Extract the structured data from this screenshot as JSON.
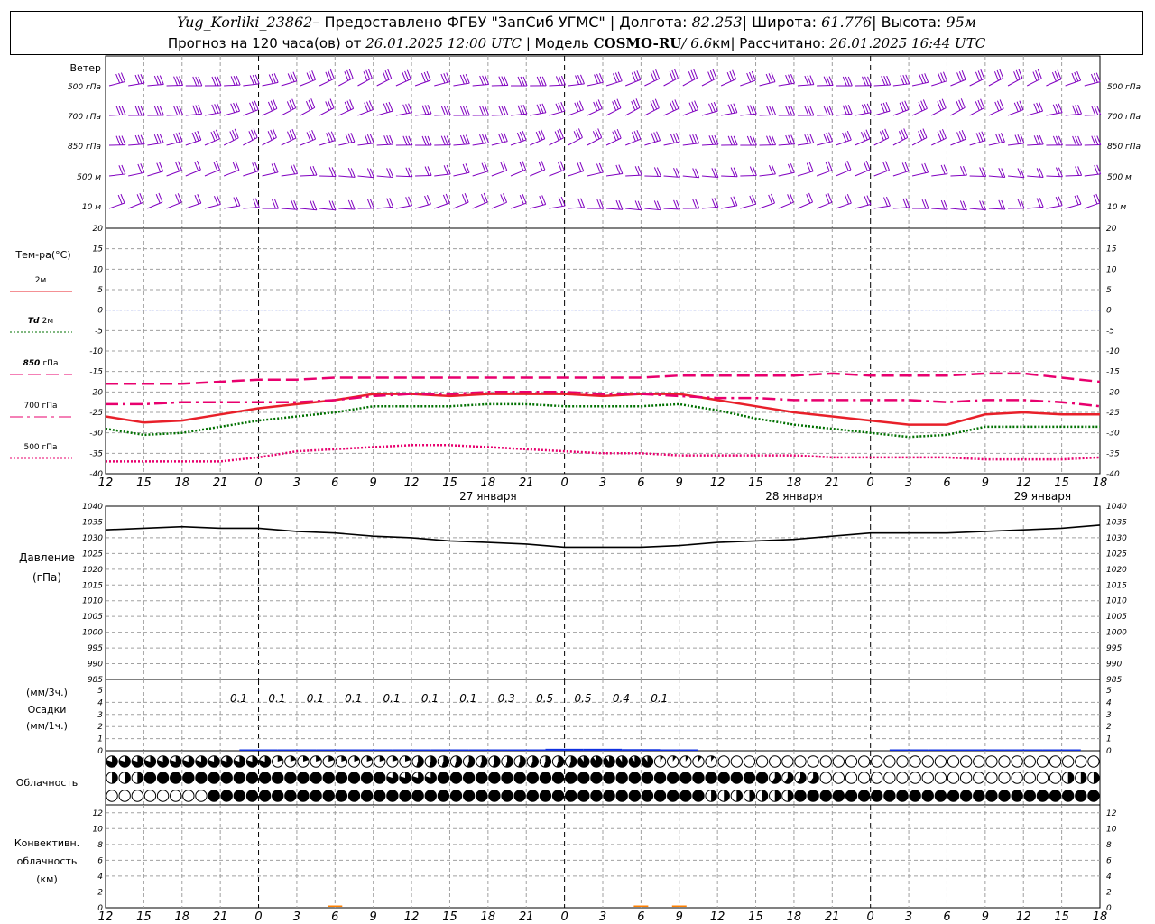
{
  "header": {
    "station": "Yug_Korliki_23862",
    "provided_prefix": " – Предоставлено ФГБУ \"ЗапСиб УГМС\" | Долгота:",
    "lon": "82.253",
    "lat_label": " | Широта:",
    "lat": "61.776",
    "alt_label": " | Высота:",
    "alt": "95м",
    "forecast_prefix": "Прогноз на 120 часа(ов) от",
    "forecast_time": "26.01.2025 12:00 UTC",
    "model_label": " | Модель",
    "model": "COSMO-RU",
    "resolution": " / 6.6",
    "resolution_unit": "км",
    "calc_label": " | Рассчитано:",
    "calc_time": "26.01.2025 16:44 UTC"
  },
  "time_axis": {
    "hour_labels": [
      "12",
      "15",
      "18",
      "21",
      "0",
      "3",
      "6",
      "9",
      "12",
      "15",
      "18",
      "21",
      "0",
      "3",
      "6",
      "9",
      "12",
      "15",
      "18",
      "21",
      "0",
      "3",
      "6",
      "9",
      "12",
      "15",
      "18"
    ],
    "date_labels": [
      {
        "text": "27 января",
        "at_index": 10
      },
      {
        "text": "28 января",
        "at_index": 18
      },
      {
        "text": "29 января",
        "at_index": 24.5
      }
    ]
  },
  "wind_panel": {
    "title": "Ветер",
    "levels": [
      "500 гПа",
      "700 гПа",
      "850 гПа",
      "500 м",
      "10 м"
    ],
    "barb_color": "#8000c0"
  },
  "temp_panel": {
    "title": "Тем-ра(°C)",
    "legend": [
      {
        "label": "2м",
        "color": "#e8202a",
        "style": "solid"
      },
      {
        "label_italic": "Td",
        "label": "2м",
        "color": "#007000",
        "style": "dotted"
      },
      {
        "label_italic": "850",
        "label": "гПа",
        "color": "#e8006e",
        "style": "dashed"
      },
      {
        "label": "700 гПа",
        "color": "#e8006e",
        "style": "dashdot"
      },
      {
        "label": "500 гПа",
        "color": "#e8006e",
        "style": "dotted"
      }
    ],
    "ticks": [
      "20",
      "15",
      "10",
      "5",
      "0",
      "-5",
      "-10",
      "-15",
      "-20",
      "-25",
      "-30",
      "-35",
      "-40"
    ]
  },
  "pressure_panel": {
    "title1": "Давление",
    "title2": "(гПа)",
    "ticks": [
      "1040",
      "1035",
      "1030",
      "1025",
      "1020",
      "1015",
      "1010",
      "1005",
      "1000",
      "995",
      "990",
      "985"
    ]
  },
  "precip_panel": {
    "title1": "(мм/3ч.)",
    "title2": "Осадки",
    "title3": "(мм/1ч.)",
    "ticks": [
      "5",
      "4",
      "3",
      "2",
      "1",
      "0"
    ],
    "amounts": [
      "0.1",
      "0.1",
      "0.1",
      "0.1",
      "0.1",
      "0.1",
      "0.1",
      "0.3",
      "0.5",
      "0.5",
      "0.4",
      "0.1"
    ]
  },
  "cloud_panel": {
    "title": "Облачность"
  },
  "conv_panel": {
    "title1": "Конвективн.",
    "title2": "облачность",
    "title3": "(км)",
    "ticks": [
      "12",
      "10",
      "8",
      "6",
      "4",
      "2",
      "0"
    ]
  },
  "chart_data": [
    {
      "type": "line",
      "title": "Тем-ра(°C)",
      "x": [
        "12",
        "15",
        "18",
        "21",
        "0",
        "3",
        "6",
        "9",
        "12",
        "15",
        "18",
        "21",
        "0",
        "3",
        "6",
        "9",
        "12",
        "15",
        "18",
        "21",
        "0",
        "3",
        "6",
        "9",
        "12",
        "15",
        "18"
      ],
      "ylim": [
        -40,
        20
      ],
      "series": [
        {
          "name": "2м",
          "color": "#e8202a",
          "values": [
            -26,
            -27.5,
            -27,
            -25.5,
            -24,
            -23,
            -22,
            -20.5,
            -20.5,
            -21,
            -20.5,
            -20.5,
            -20.5,
            -21,
            -20.5,
            -20.5,
            -22,
            -23.5,
            -25,
            -26,
            -27,
            -28,
            -28,
            -25.5,
            -25,
            -25.5,
            -25.5
          ]
        },
        {
          "name": "Td 2м",
          "color": "#007000",
          "values": [
            -29,
            -30.5,
            -30,
            -28.5,
            -27,
            -26,
            -25,
            -23.5,
            -23.5,
            -23.5,
            -23,
            -23,
            -23.5,
            -23.5,
            -23.5,
            -23,
            -24.5,
            -26.5,
            -28,
            -29,
            -30,
            -31,
            -30.5,
            -28.5,
            -28.5,
            -28.5,
            -28.5
          ]
        },
        {
          "name": "850 гПа",
          "color": "#e8006e",
          "values": [
            -18,
            -18,
            -18,
            -17.5,
            -17,
            -17,
            -16.5,
            -16.5,
            -16.5,
            -16.5,
            -16.5,
            -16.5,
            -16.5,
            -16.5,
            -16.5,
            -16,
            -16,
            -16,
            -16,
            -15.5,
            -16,
            -16,
            -16,
            -15.5,
            -15.5,
            -16.5,
            -17.5
          ]
        },
        {
          "name": "700 гПа",
          "color": "#e8006e",
          "values": [
            -23,
            -23,
            -22.5,
            -22.5,
            -22.5,
            -22.5,
            -22,
            -21,
            -20.5,
            -20.5,
            -20,
            -20,
            -20,
            -20.5,
            -20.5,
            -21,
            -21.5,
            -21.5,
            -22,
            -22,
            -22,
            -22,
            -22.5,
            -22,
            -22,
            -22.5,
            -23.5
          ]
        },
        {
          "name": "500 гПа",
          "color": "#e8006e",
          "values": [
            -37,
            -37,
            -37,
            -37,
            -36,
            -34.5,
            -34,
            -33.5,
            -33,
            -33,
            -33.5,
            -34,
            -34.5,
            -35,
            -35,
            -35.5,
            -35.5,
            -35.5,
            -35.5,
            -36,
            -36,
            -36,
            -36,
            -36.5,
            -36.5,
            -36.5,
            -36
          ]
        }
      ]
    },
    {
      "type": "line",
      "title": "Давление (гПа)",
      "x": [
        "12",
        "15",
        "18",
        "21",
        "0",
        "3",
        "6",
        "9",
        "12",
        "15",
        "18",
        "21",
        "0",
        "3",
        "6",
        "9",
        "12",
        "15",
        "18",
        "21",
        "0",
        "3",
        "6",
        "9",
        "12",
        "15",
        "18"
      ],
      "ylim": [
        985,
        1040
      ],
      "series": [
        {
          "name": "Давление",
          "color": "#000000",
          "values": [
            1032.5,
            1033,
            1033.5,
            1033,
            1033,
            1032,
            1031.5,
            1030.5,
            1030,
            1029,
            1028.5,
            1028,
            1027,
            1027,
            1027,
            1027.5,
            1028.5,
            1029,
            1029.5,
            1030.5,
            1031.5,
            1031.5,
            1031.5,
            1032,
            1032.5,
            1033,
            1034
          ]
        }
      ]
    },
    {
      "type": "bar",
      "title": "Осадки",
      "x": [
        "12",
        "15",
        "18",
        "21",
        "0",
        "3",
        "6",
        "9",
        "12",
        "15",
        "18",
        "21",
        "0",
        "3",
        "6",
        "9",
        "12",
        "15",
        "18",
        "21",
        "0",
        "3",
        "6",
        "9",
        "12",
        "15",
        "18"
      ],
      "ylim": [
        0,
        5
      ],
      "series": [
        {
          "name": "Осадки",
          "color": "#1030e0",
          "values": [
            0,
            0,
            0,
            0,
            0.04,
            0.04,
            0.04,
            0.03,
            0.03,
            0.03,
            0.06,
            0.1,
            0.16,
            0.16,
            0.13,
            0.04,
            0,
            0,
            0,
            0,
            0,
            0.02,
            0.02,
            0.02,
            0.02,
            0.02,
            0
          ]
        }
      ]
    },
    {
      "type": "bar",
      "title": "Конвективн. облачность (км)",
      "ylim": [
        0,
        13
      ],
      "series": [
        {
          "name": "Конвективн. облачность",
          "color": "#ff8000",
          "values": [
            0,
            0,
            0,
            0,
            0,
            0,
            0.2,
            0,
            0,
            0,
            0,
            0,
            0,
            0,
            0.2,
            0.2,
            0,
            0,
            0,
            0,
            0,
            0,
            0,
            0,
            0,
            0,
            0
          ]
        }
      ]
    }
  ]
}
